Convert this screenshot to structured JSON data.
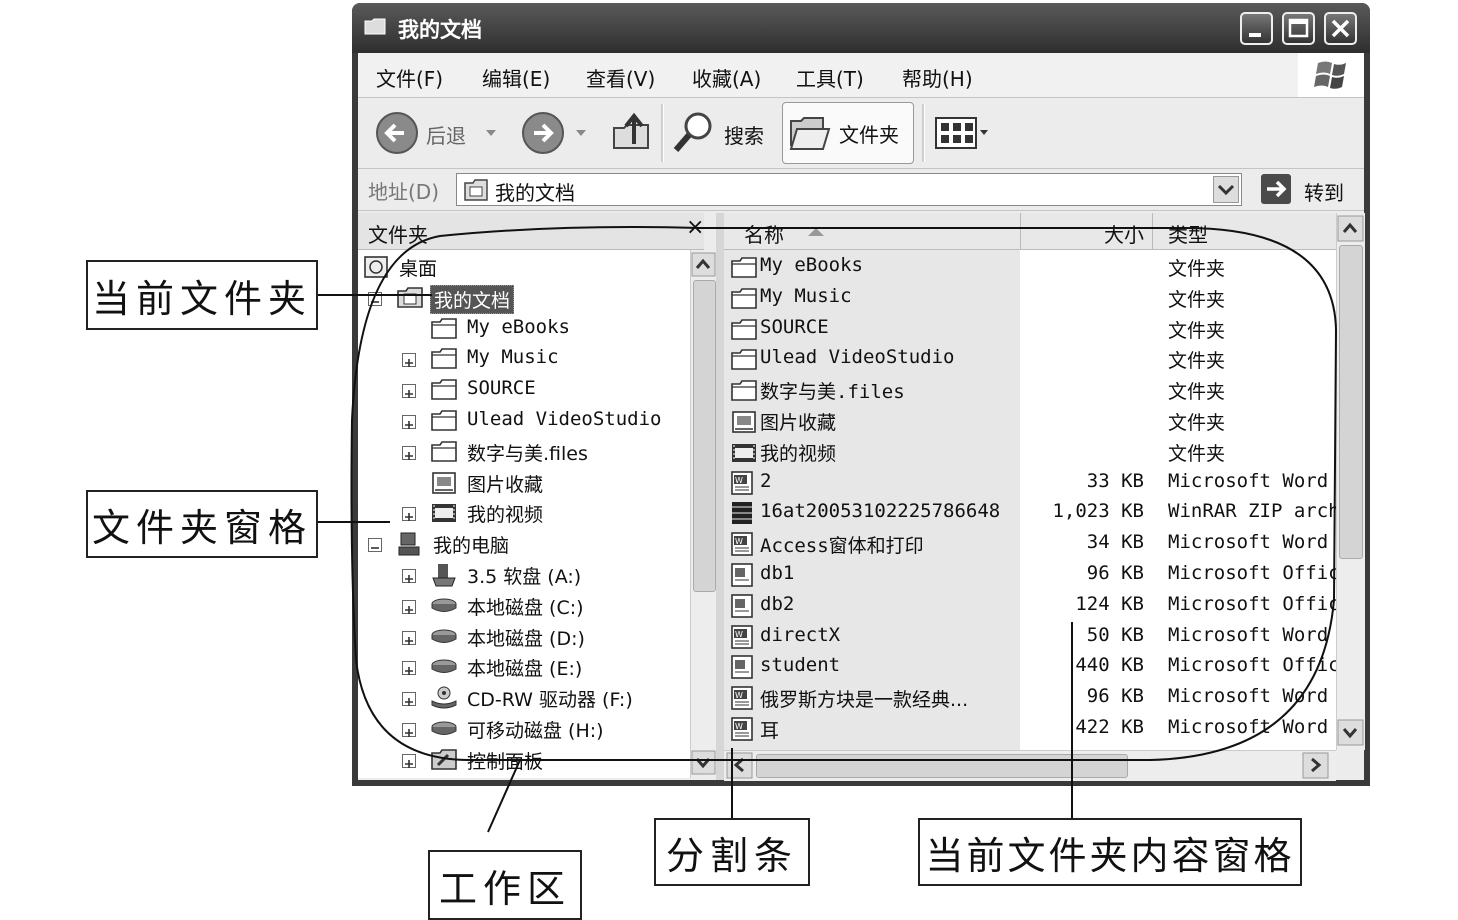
{
  "window": {
    "title": "我的文档"
  },
  "menubar": {
    "items": [
      "文件(F)",
      "编辑(E)",
      "查看(V)",
      "收藏(A)",
      "工具(T)",
      "帮助(H)"
    ]
  },
  "toolbar": {
    "back_label": "后退",
    "search_label": "搜索",
    "folders_label": "文件夹"
  },
  "address": {
    "label": "地址(D)",
    "value": "我的文档",
    "go_label": "转到"
  },
  "tree": {
    "header": "文件夹",
    "close_glyph": "×",
    "nodes": [
      {
        "label": "桌面",
        "level": 0,
        "expander": "none",
        "icon": "desktop-icon"
      },
      {
        "label": "我的文档",
        "level": 1,
        "expander": "minus",
        "icon": "documents-icon",
        "selected": true
      },
      {
        "label": "My eBooks",
        "level": 2,
        "expander": "none",
        "icon": "folder-icon"
      },
      {
        "label": "My Music",
        "level": 2,
        "expander": "plus",
        "icon": "folder-icon"
      },
      {
        "label": "SOURCE",
        "level": 2,
        "expander": "plus",
        "icon": "folder-icon"
      },
      {
        "label": "Ulead VideoStudio",
        "level": 2,
        "expander": "plus",
        "icon": "folder-icon"
      },
      {
        "label": "数字与美.files",
        "level": 2,
        "expander": "plus",
        "icon": "folder-icon"
      },
      {
        "label": "图片收藏",
        "level": 2,
        "expander": "none",
        "icon": "pictures-icon"
      },
      {
        "label": "我的视频",
        "level": 2,
        "expander": "plus",
        "icon": "video-icon"
      },
      {
        "label": "我的电脑",
        "level": 1,
        "expander": "minus",
        "icon": "computer-icon"
      },
      {
        "label": "3.5 软盘 (A:)",
        "level": 2,
        "expander": "plus",
        "icon": "floppy-icon"
      },
      {
        "label": "本地磁盘 (C:)",
        "level": 2,
        "expander": "plus",
        "icon": "disk-icon"
      },
      {
        "label": "本地磁盘 (D:)",
        "level": 2,
        "expander": "plus",
        "icon": "disk-icon"
      },
      {
        "label": "本地磁盘 (E:)",
        "level": 2,
        "expander": "plus",
        "icon": "disk-icon"
      },
      {
        "label": "CD-RW 驱动器 (F:)",
        "level": 2,
        "expander": "plus",
        "icon": "cd-icon"
      },
      {
        "label": "可移动磁盘 (H:)",
        "level": 2,
        "expander": "plus",
        "icon": "disk-icon"
      },
      {
        "label": "控制面板",
        "level": 2,
        "expander": "plus",
        "icon": "control-panel-icon"
      }
    ]
  },
  "list": {
    "columns": {
      "name": "名称",
      "size": "大小",
      "type": "类型"
    },
    "rows": [
      {
        "name": "My eBooks",
        "size": "",
        "type": "文件夹",
        "icon": "folder-icon"
      },
      {
        "name": "My Music",
        "size": "",
        "type": "文件夹",
        "icon": "folder-icon"
      },
      {
        "name": "SOURCE",
        "size": "",
        "type": "文件夹",
        "icon": "folder-icon"
      },
      {
        "name": "Ulead VideoStudio",
        "size": "",
        "type": "文件夹",
        "icon": "folder-icon"
      },
      {
        "name": "数字与美.files",
        "size": "",
        "type": "文件夹",
        "icon": "folder-icon"
      },
      {
        "name": "图片收藏",
        "size": "",
        "type": "文件夹",
        "icon": "pictures-icon"
      },
      {
        "name": "我的视频",
        "size": "",
        "type": "文件夹",
        "icon": "video-icon"
      },
      {
        "name": "2",
        "size": "33 KB",
        "type": "Microsoft Word",
        "icon": "word-doc-icon"
      },
      {
        "name": "16at20053102225786648",
        "size": "1,023 KB",
        "type": "WinRAR ZIP arch",
        "icon": "zip-icon"
      },
      {
        "name": "Access窗体和打印",
        "size": "34 KB",
        "type": "Microsoft Word",
        "icon": "word-doc-icon"
      },
      {
        "name": "db1",
        "size": "96 KB",
        "type": "Microsoft Offic",
        "icon": "office-doc-icon"
      },
      {
        "name": "db2",
        "size": "124 KB",
        "type": "Microsoft Offic",
        "icon": "office-doc-icon"
      },
      {
        "name": "directX",
        "size": "50 KB",
        "type": "Microsoft Word",
        "icon": "word-doc-icon"
      },
      {
        "name": "student",
        "size": "440 KB",
        "type": "Microsoft Offic",
        "icon": "office-doc-icon"
      },
      {
        "name": "俄罗斯方块是一款经典...",
        "size": "96 KB",
        "type": "Microsoft Word",
        "icon": "word-doc-icon"
      },
      {
        "name": "耳",
        "size": "422 KB",
        "type": "Microsoft Word",
        "icon": "word-doc-icon"
      }
    ]
  },
  "callouts": {
    "current_folder": "当前文件夹",
    "folder_pane": "文件夹窗格",
    "work_area": "工作区",
    "splitter": "分割条",
    "content_pane": "当前文件夹内容窗格"
  }
}
